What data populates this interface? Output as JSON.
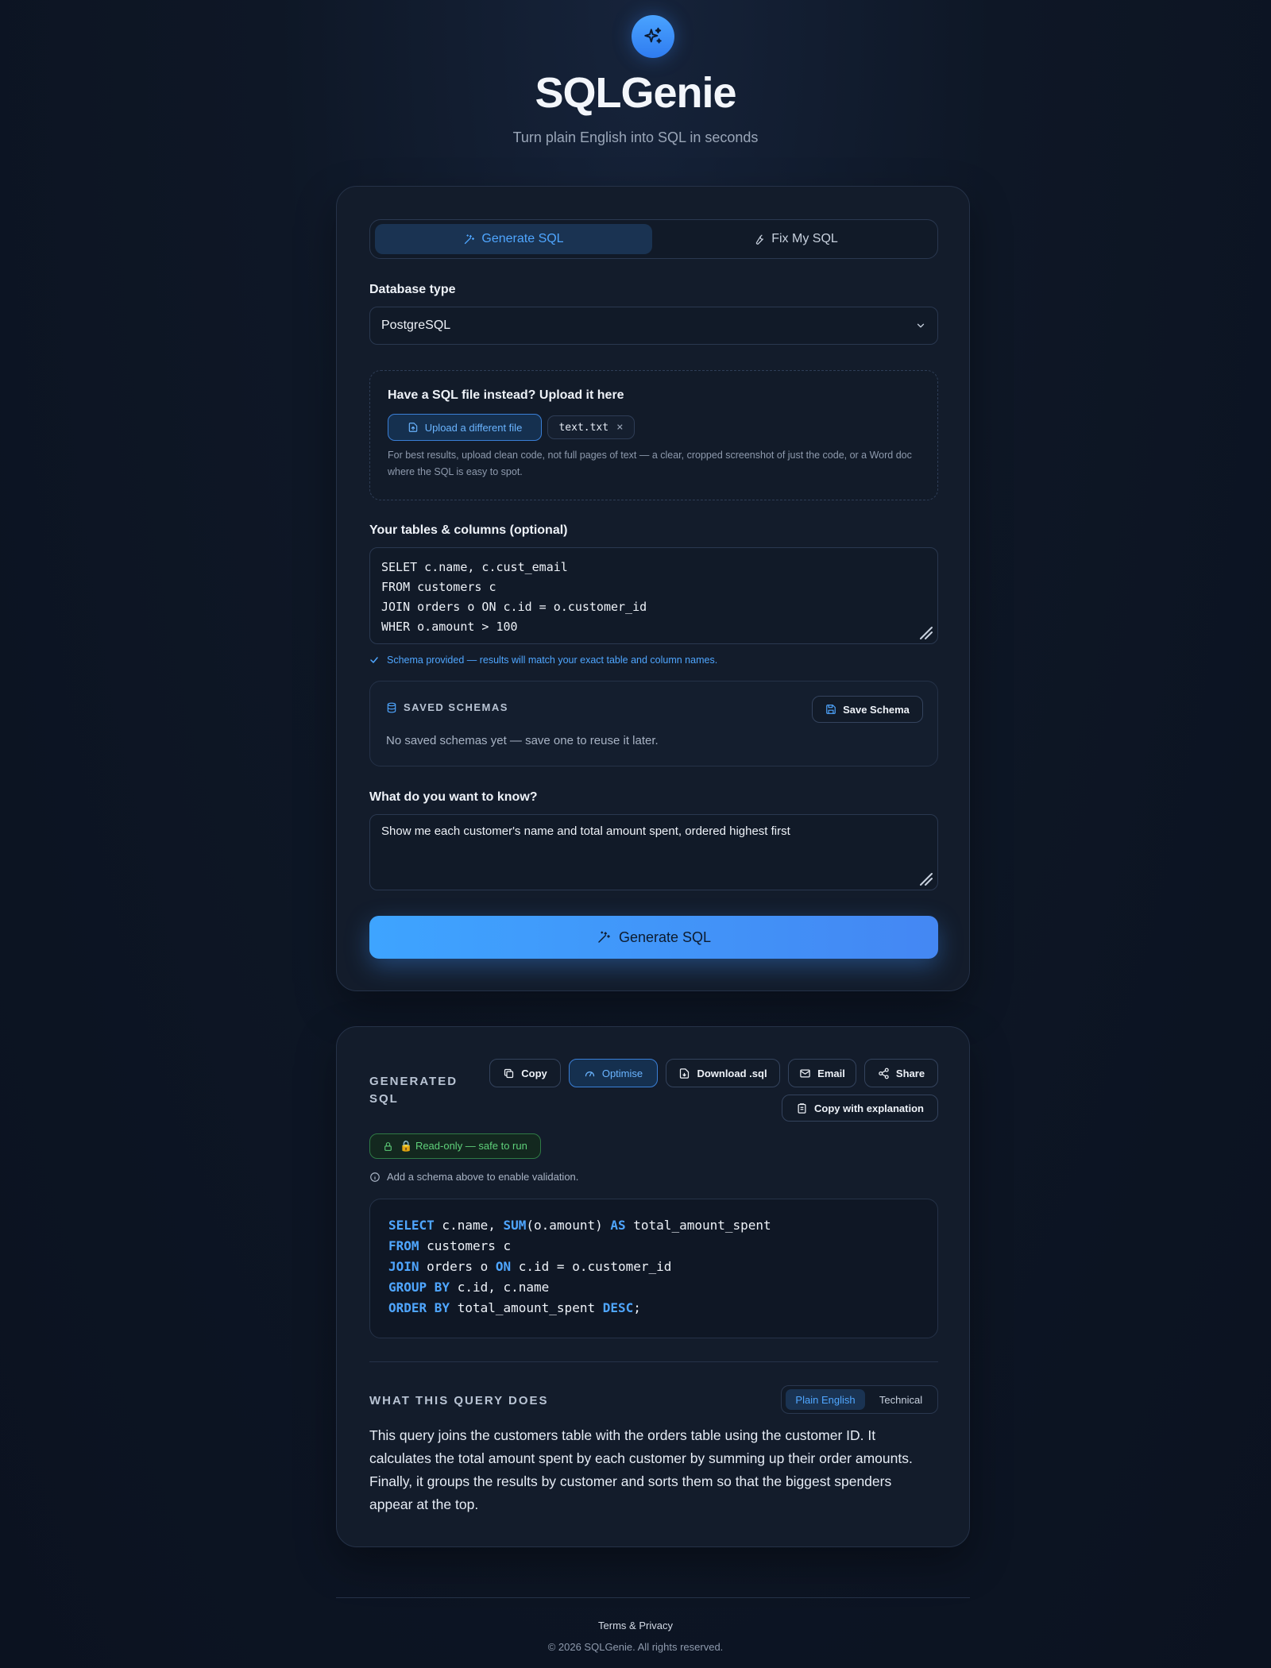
{
  "app": {
    "title": "SQLGenie",
    "subtitle": "Turn plain English into SQL in seconds"
  },
  "tabs": [
    {
      "label": "Generate SQL",
      "active": true,
      "icon": "magic-wand-icon"
    },
    {
      "label": "Fix My SQL",
      "active": false,
      "icon": "wrench-icon"
    }
  ],
  "database": {
    "label": "Database type",
    "selected": "PostgreSQL"
  },
  "upload": {
    "title": "Have a SQL file instead? Upload it here",
    "button_label": "Upload a different file",
    "file_name": "text.txt",
    "help": "For best results, upload clean code, not full pages of text — a clear, cropped screenshot of just the code, or a Word doc where the SQL is easy to spot."
  },
  "schema": {
    "label": "Your tables & columns (optional)",
    "value": "SELET c.name, c.cust_email\nFROM customers c\nJOIN orders o ON c.id = o.customer_id\nWHER o.amount > 100",
    "note": "Schema provided — results will match your exact table and column names."
  },
  "saved_schemas": {
    "title": "SAVED SCHEMAS",
    "save_button": "Save Schema",
    "empty_text": "No saved schemas yet — save one to reuse it later."
  },
  "question": {
    "label": "What do you want to know?",
    "value": "Show me each customer's name and total amount spent, ordered highest first"
  },
  "generate_button": "Generate SQL",
  "result": {
    "title": "GENERATED SQL",
    "actions": {
      "copy": "Copy",
      "optimise": "Optimise",
      "download": "Download .sql",
      "email": "Email",
      "share": "Share",
      "copy_explanation": "Copy with explanation"
    },
    "badge": "🔒 Read-only — safe to run",
    "validation_note": "Add a schema above to enable validation.",
    "code_lines": [
      [
        {
          "t": "SELECT",
          "k": true
        },
        {
          "t": " c.name, ",
          "k": false
        },
        {
          "t": "SUM",
          "k": true
        },
        {
          "t": "(o.amount) ",
          "k": false
        },
        {
          "t": "AS",
          "k": true
        },
        {
          "t": " total_amount_spent",
          "k": false
        }
      ],
      [
        {
          "t": "FROM",
          "k": true
        },
        {
          "t": " customers c",
          "k": false
        }
      ],
      [
        {
          "t": "JOIN",
          "k": true
        },
        {
          "t": " orders o ",
          "k": false
        },
        {
          "t": "ON",
          "k": true
        },
        {
          "t": " c.id = o.customer_id",
          "k": false
        }
      ],
      [
        {
          "t": "GROUP BY",
          "k": true
        },
        {
          "t": " c.id, c.name",
          "k": false
        }
      ],
      [
        {
          "t": "ORDER BY",
          "k": true
        },
        {
          "t": " total_amount_spent ",
          "k": false
        },
        {
          "t": "DESC",
          "k": true
        },
        {
          "t": ";",
          "k": false
        }
      ]
    ],
    "what_title": "WHAT THIS QUERY DOES",
    "toggle": {
      "plain": "Plain English",
      "technical": "Technical",
      "selected": "Plain English"
    },
    "explanation": "This query joins the customers table with the orders table using the customer ID. It calculates the total amount spent by each customer by summing up their order amounts. Finally, it groups the results by customer and sorts them so that the biggest spenders appear at the top."
  },
  "footer": {
    "link": "Terms & Privacy",
    "copyright": "© 2026 SQLGenie. All rights reserved."
  },
  "colors": {
    "accent": "#4fa6ff",
    "background": "#0e1726",
    "card": "#131c2b",
    "success": "#5fd07a"
  }
}
